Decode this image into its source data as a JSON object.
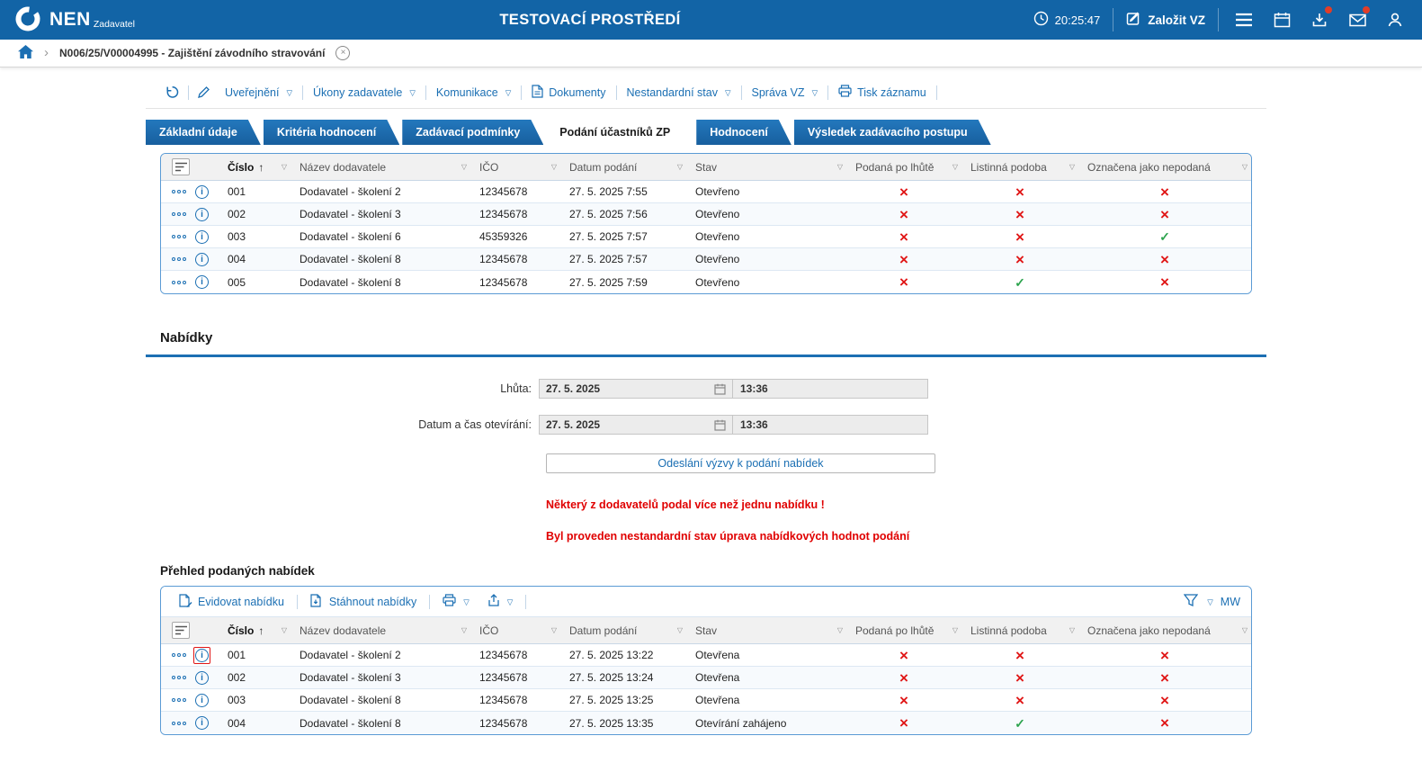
{
  "topbar": {
    "logo": "NEN",
    "logo_sub": "Zadavatel",
    "env_title": "TESTOVACÍ PROSTŘEDÍ",
    "time": "20:25:47",
    "create_button": "Založit VZ"
  },
  "breadcrumb": {
    "path": "N006/25/V00004995 - Zajištění závodního stravování"
  },
  "toolbar": {
    "items": [
      "Uveřejnění",
      "Úkony zadavatele",
      "Komunikace",
      "Dokumenty",
      "Nestandardní stav",
      "Správa VZ",
      "Tisk záznamu"
    ]
  },
  "tabs": [
    "Základní údaje",
    "Kritéria hodnocení",
    "Zadávací podmínky",
    "Podání účastníků ZP",
    "Hodnocení",
    "Výsledek zadávacího postupu"
  ],
  "table_columns": [
    "Číslo",
    "Název dodavatele",
    "IČO",
    "Datum podání",
    "Stav",
    "Podaná po lhůtě",
    "Listinná podoba",
    "Označena jako nepodaná"
  ],
  "icons": {
    "cross": "×",
    "check": "✓",
    "dropdown": "▽",
    "sort_asc": "↑",
    "chevron": "›",
    "close": "×",
    "info": "i"
  },
  "colors": {
    "accent": "#1b6fb3",
    "topbar": "#1264a6",
    "red": "#e01616",
    "green": "#2ea44f",
    "table_border": "#5b9bd5"
  },
  "submissions_table": {
    "rows": [
      {
        "cislo": "001",
        "nazev": "Dodavatel - školení 2",
        "ico": "12345678",
        "datum": "27. 5. 2025 7:55",
        "stav": "Otevřeno",
        "po_lhute": "x",
        "listinna": "x",
        "nepodana": "x"
      },
      {
        "cislo": "002",
        "nazev": "Dodavatel - školení 3",
        "ico": "12345678",
        "datum": "27. 5. 2025 7:56",
        "stav": "Otevřeno",
        "po_lhute": "x",
        "listinna": "x",
        "nepodana": "x"
      },
      {
        "cislo": "003",
        "nazev": "Dodavatel - školení 6",
        "ico": "45359326",
        "datum": "27. 5. 2025 7:57",
        "stav": "Otevřeno",
        "po_lhute": "x",
        "listinna": "x",
        "nepodana": "check"
      },
      {
        "cislo": "004",
        "nazev": "Dodavatel - školení 8",
        "ico": "12345678",
        "datum": "27. 5. 2025 7:57",
        "stav": "Otevřeno",
        "po_lhute": "x",
        "listinna": "x",
        "nepodana": "x"
      },
      {
        "cislo": "005",
        "nazev": "Dodavatel - školení 8",
        "ico": "12345678",
        "datum": "27. 5. 2025 7:59",
        "stav": "Otevřeno",
        "po_lhute": "x",
        "listinna": "check",
        "nepodana": "x"
      }
    ]
  },
  "nabidky": {
    "section_title": "Nabídky",
    "lhuta_label": "Lhůta:",
    "lhuta_date": "27. 5. 2025",
    "lhuta_time": "13:36",
    "oteviranie_label": "Datum a čas otevírání:",
    "oteviranie_date": "27. 5. 2025",
    "oteviranie_time": "13:36",
    "send_button": "Odeslání výzvy k podání nabídek",
    "warning1": "Některý z dodavatelů podal více než jednu nabídku !",
    "warning2": "Byl proveden nestandardní stav úprava nabídkových hodnot podání",
    "subheading": "Přehled podaných nabídek",
    "actions": {
      "evidovat": "Evidovat nabídku",
      "stahnout": "Stáhnout nabídky",
      "mw_label": "MW"
    }
  },
  "offers_table": {
    "rows": [
      {
        "cislo": "001",
        "nazev": "Dodavatel - školení 2",
        "ico": "12345678",
        "datum": "27. 5. 2025 13:22",
        "stav": "Otevřena",
        "po_lhute": "x",
        "listinna": "x",
        "nepodana": "x",
        "info_highlight": true
      },
      {
        "cislo": "002",
        "nazev": "Dodavatel - školení 3",
        "ico": "12345678",
        "datum": "27. 5. 2025 13:24",
        "stav": "Otevřena",
        "po_lhute": "x",
        "listinna": "x",
        "nepodana": "x"
      },
      {
        "cislo": "003",
        "nazev": "Dodavatel - školení 8",
        "ico": "12345678",
        "datum": "27. 5. 2025 13:25",
        "stav": "Otevřena",
        "po_lhute": "x",
        "listinna": "x",
        "nepodana": "x"
      },
      {
        "cislo": "004",
        "nazev": "Dodavatel - školení 8",
        "ico": "12345678",
        "datum": "27. 5. 2025 13:35",
        "stav": "Otevírání zahájeno",
        "po_lhute": "x",
        "listinna": "check",
        "nepodana": "x"
      }
    ]
  }
}
